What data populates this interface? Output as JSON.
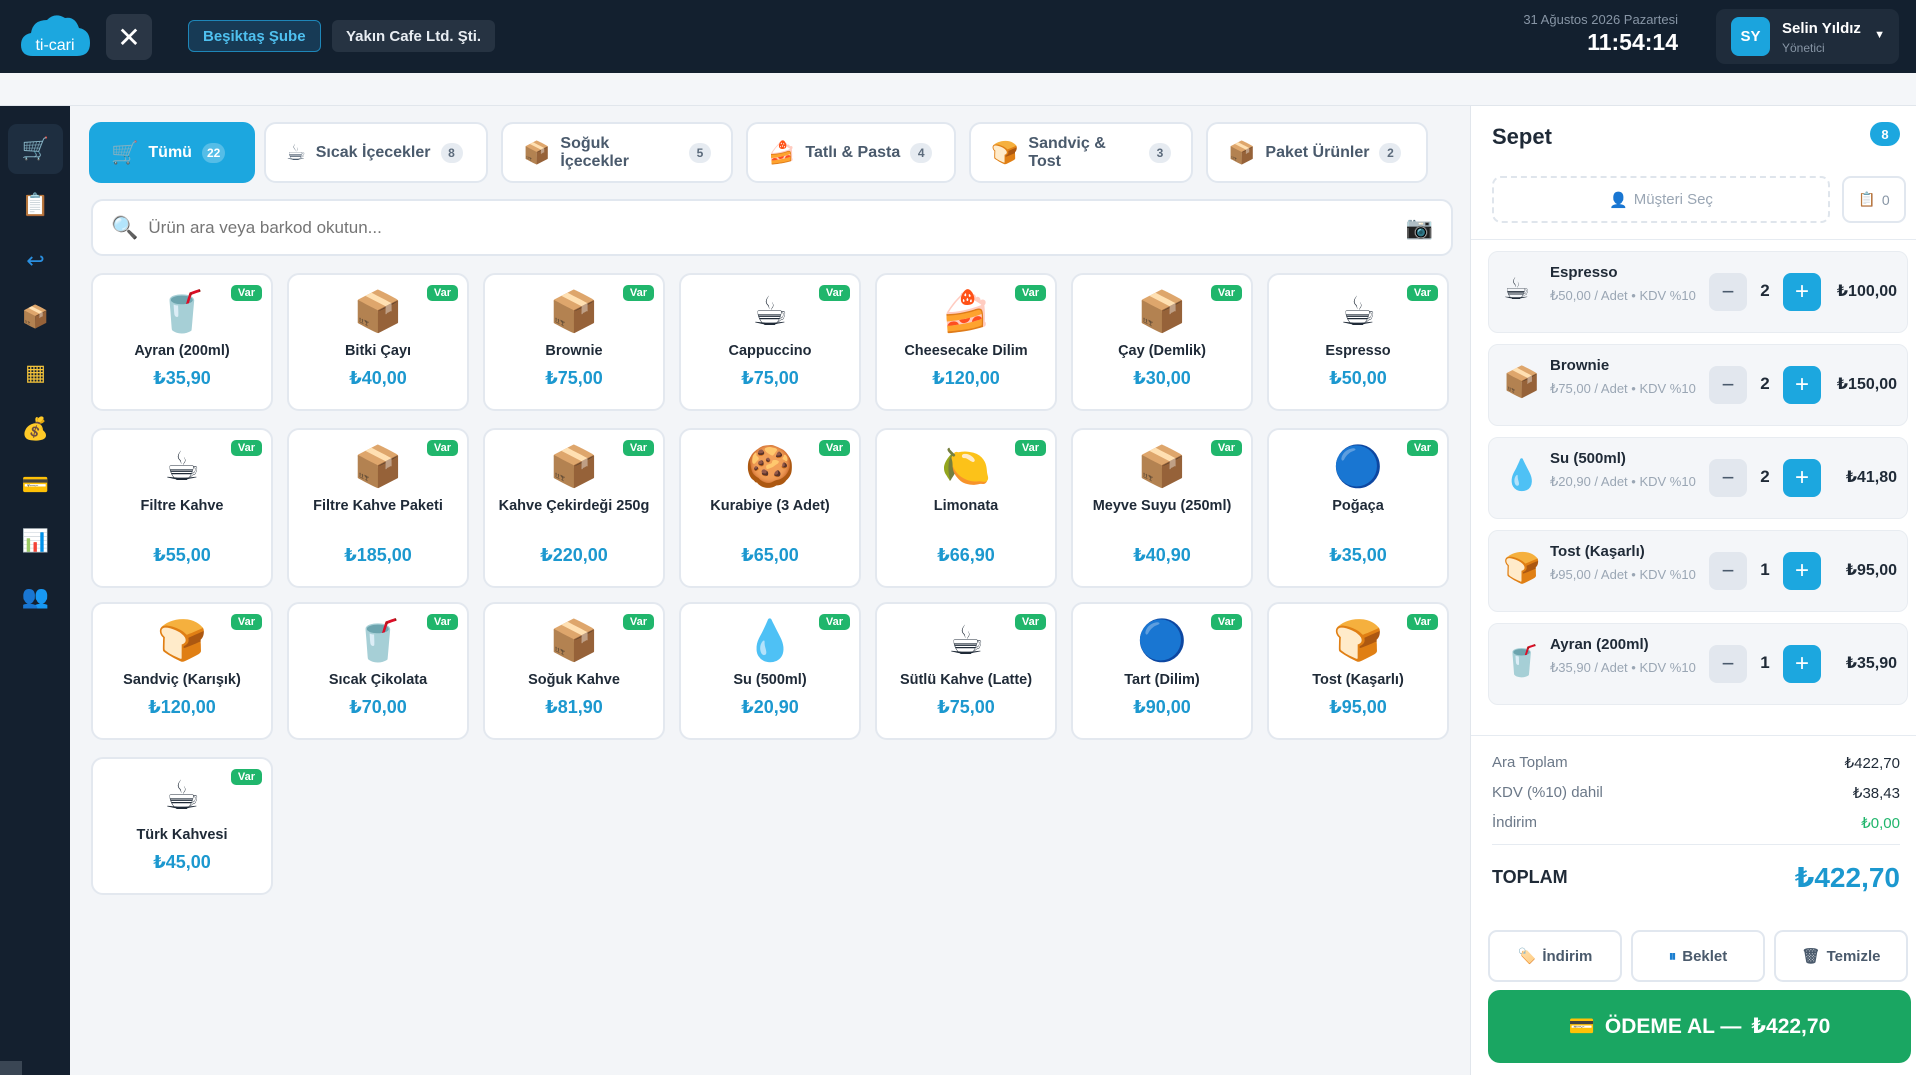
{
  "header": {
    "logo_text": "ti-cari",
    "branch": "Beşiktaş Şube",
    "company": "Yakın Cafe Ltd. Şti.",
    "date": "31 Ağustos 2026 Pazartesi",
    "time": "11:54:14",
    "user": {
      "initials": "SY",
      "name": "Selin Yıldız",
      "role": "Yönetici"
    }
  },
  "categories": [
    {
      "label": "Tümü",
      "count": "22",
      "icon": "cart-icon",
      "active": true
    },
    {
      "label": "Sıcak İçecekler",
      "count": "8",
      "icon": "coffee-icon"
    },
    {
      "label": "Soğuk İçecekler",
      "count": "5",
      "icon": "box-icon"
    },
    {
      "label": "Tatlı & Pasta",
      "count": "4",
      "icon": "cake-icon"
    },
    {
      "label": "Sandviç & Tost",
      "count": "3",
      "icon": "toast-icon"
    },
    {
      "label": "Paket Ürünler",
      "count": "2",
      "icon": "box-icon"
    }
  ],
  "search": {
    "placeholder": "Ürün ara veya barkod okutun..."
  },
  "stock_badge": "Var",
  "products": [
    {
      "name": "Ayran (200ml)",
      "price": "₺35,90",
      "icon": "cup-straw-icon"
    },
    {
      "name": "Bitki Çayı",
      "price": "₺40,00",
      "icon": "box-icon"
    },
    {
      "name": "Brownie",
      "price": "₺75,00",
      "icon": "box-icon"
    },
    {
      "name": "Cappuccino",
      "price": "₺75,00",
      "icon": "coffee-icon"
    },
    {
      "name": "Cheesecake Dilim",
      "price": "₺120,00",
      "icon": "cake-icon"
    },
    {
      "name": "Çay (Demlik)",
      "price": "₺30,00",
      "icon": "box-icon"
    },
    {
      "name": "Espresso",
      "price": "₺50,00",
      "icon": "coffee-icon"
    },
    {
      "name": "Filtre Kahve",
      "price": "₺55,00",
      "icon": "coffee-icon"
    },
    {
      "name": "Filtre Kahve Paketi",
      "price": "₺185,00",
      "icon": "box-icon"
    },
    {
      "name": "Kahve Çekirdeği 250g",
      "price": "₺220,00",
      "icon": "box-icon"
    },
    {
      "name": "Kurabiye (3 Adet)",
      "price": "₺65,00",
      "icon": "cookie-icon"
    },
    {
      "name": "Limonata",
      "price": "₺66,90",
      "icon": "lemon-icon"
    },
    {
      "name": "Meyve Suyu (250ml)",
      "price": "₺40,90",
      "icon": "box-icon"
    },
    {
      "name": "Poğaça",
      "price": "₺35,00",
      "icon": "circle-icon"
    },
    {
      "name": "Sandviç (Karışık)",
      "price": "₺120,00",
      "icon": "toast-icon"
    },
    {
      "name": "Sıcak Çikolata",
      "price": "₺70,00",
      "icon": "cup-straw-icon"
    },
    {
      "name": "Soğuk Kahve",
      "price": "₺81,90",
      "icon": "box-icon"
    },
    {
      "name": "Su (500ml)",
      "price": "₺20,90",
      "icon": "droplet-icon"
    },
    {
      "name": "Sütlü Kahve (Latte)",
      "price": "₺75,00",
      "icon": "coffee-icon"
    },
    {
      "name": "Tart (Dilim)",
      "price": "₺90,00",
      "icon": "circle-icon"
    },
    {
      "name": "Tost (Kaşarlı)",
      "price": "₺95,00",
      "icon": "toast-icon"
    },
    {
      "name": "Türk Kahvesi",
      "price": "₺45,00",
      "icon": "coffee-icon"
    }
  ],
  "cart": {
    "title": "Sepet",
    "count": "8",
    "customer_placeholder": "Müşteri Seç",
    "note_count": "0",
    "items": [
      {
        "name": "Espresso",
        "meta_price": "₺50,00 / Adet",
        "meta_tax": "KDV %10",
        "qty": "2",
        "total": "₺100,00",
        "icon": "coffee-icon"
      },
      {
        "name": "Brownie",
        "meta_price": "₺75,00 / Adet",
        "meta_tax": "KDV %10",
        "qty": "2",
        "total": "₺150,00",
        "icon": "box-icon"
      },
      {
        "name": "Su (500ml)",
        "meta_price": "₺20,90 / Adet",
        "meta_tax": "KDV %10",
        "qty": "2",
        "total": "₺41,80",
        "icon": "droplet-icon"
      },
      {
        "name": "Tost (Kaşarlı)",
        "meta_price": "₺95,00 / Adet",
        "meta_tax": "KDV %10",
        "qty": "1",
        "total": "₺95,00",
        "icon": "toast-icon"
      },
      {
        "name": "Ayran (200ml)",
        "meta_price": "₺35,90 / Adet",
        "meta_tax": "KDV %10",
        "qty": "1",
        "total": "₺35,90",
        "icon": "cup-straw-icon"
      }
    ],
    "summary": {
      "subtotal_label": "Ara Toplam",
      "subtotal": "₺422,70",
      "tax_label": "KDV (%10) dahil",
      "tax": "₺38,43",
      "discount_label": "İndirim",
      "discount": "₺0,00",
      "total_label": "TOPLAM",
      "total": "₺422,70"
    },
    "actions": {
      "discount": "İndirim",
      "hold": "Beklet",
      "clear": "Temizle"
    },
    "pay_label": "ÖDEME AL —",
    "pay_amount": "₺422,70"
  },
  "sidebar": [
    "cart-icon",
    "clipboard-icon",
    "return-icon",
    "box-icon",
    "grid-icon",
    "money-bag-icon",
    "card-icon",
    "chart-icon",
    "users-icon"
  ]
}
